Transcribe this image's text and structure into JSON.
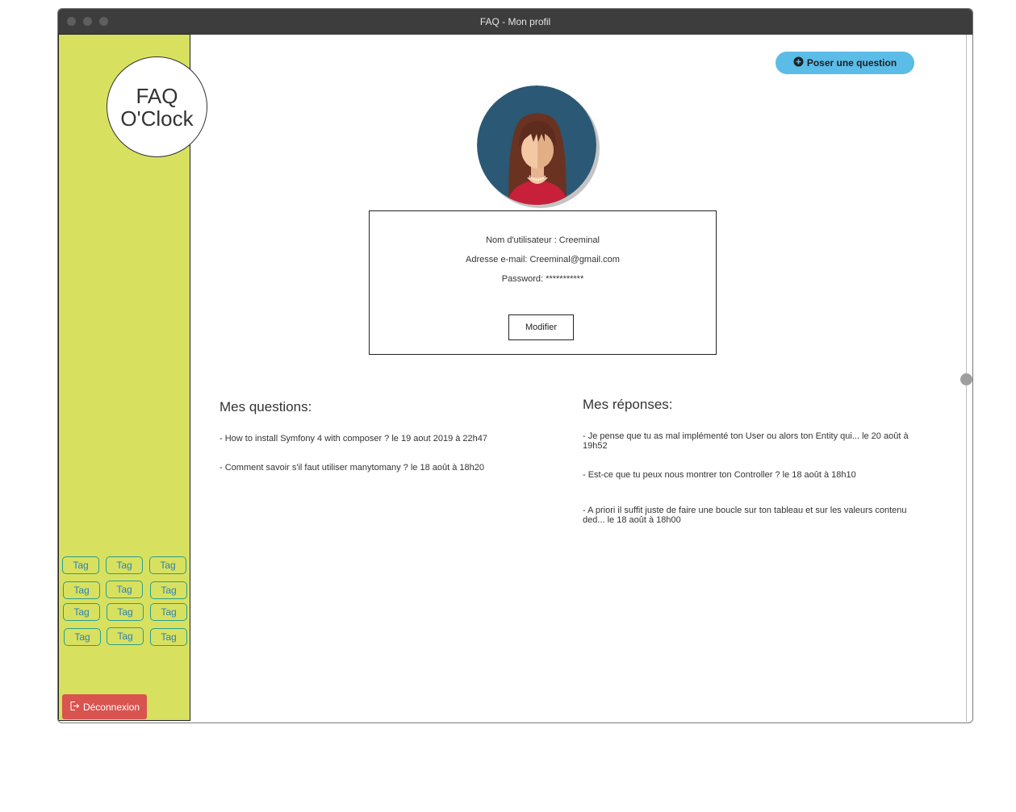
{
  "window": {
    "title": "FAQ - Mon profil"
  },
  "sidebar": {
    "logo_line1": "FAQ",
    "logo_line2": "O'Clock",
    "tags": [
      "Tag",
      "Tag",
      "Tag",
      "Tag",
      "Tag",
      "Tag",
      "Tag",
      "Tag",
      "Tag",
      "Tag",
      "Tag",
      "Tag"
    ],
    "logout_label": "Déconnexion"
  },
  "header": {
    "ask_button_label": "Poser une question"
  },
  "profile": {
    "username_line": "Nom d'utilisateur : Creeminal",
    "email_line": "Adresse e-mail: Creeminal@gmail.com",
    "password_line": "Password: ***********",
    "modify_label": "Modifier"
  },
  "questions": {
    "title": "Mes questions:",
    "items": [
      "- How to install Symfony 4 with composer ? le 19 aout 2019 à 22h47",
      "- Comment savoir s'il faut utiliser manytomany ? le 18 août à 18h20"
    ]
  },
  "answers": {
    "title": "Mes réponses:",
    "items": [
      "- Je pense que tu as mal implémenté ton User ou alors ton Entity qui... le 20 août à 19h52",
      "- Est-ce que tu peux nous montrer ton Controller ? le 18 août à 18h10",
      "- A priori il suffit juste de faire une boucle sur ton tableau et sur les valeurs contenu ded... le 18 août à 18h00"
    ]
  },
  "colors": {
    "sidebar_bg": "#d8e15f",
    "ask_button": "#5bbce8",
    "logout_button": "#d9534f",
    "tag_border": "#2a9d8f",
    "titlebar": "#3d3d3d"
  },
  "icons": {
    "ask_button_icon": "plus-circle-icon",
    "logout_icon": "sign-out-icon",
    "avatar": "woman-avatar-icon"
  }
}
